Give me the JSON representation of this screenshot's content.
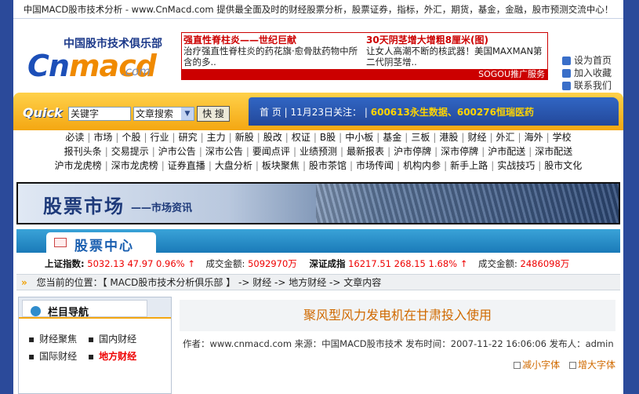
{
  "topbar": {
    "text": "中国MACD股市技术分析 - www.CnMacd.com 提供最全面及时的财经股票分析，股票证券，指标，外汇，期货，基金，金融，股市预测交流中心！"
  },
  "logo": {
    "cn_text": "中国股市技术俱乐部",
    "brand_a": "Cn",
    "brand_b": "macd",
    "domain": ".com"
  },
  "ad": {
    "left_title": "强直性脊柱炎——世纪巨献",
    "left_body": "治疗强直性脊柱炎的药花旗·愈骨肽药物中所含的多..",
    "right_title": "30天阴茎增大增粗8厘米(图)",
    "right_body": "让女人高潮不断的核武器！美国MAXMAN第二代阴茎增..",
    "footer": "SOGOU推广服务"
  },
  "quick_links": [
    "设为首页",
    "加入收藏",
    "联系我们"
  ],
  "search": {
    "logo_text": "Quick",
    "keyword_value": "关键字",
    "select_value": "文章搜索",
    "go_label": "快 搜"
  },
  "bluebar": {
    "home": "首 页",
    "date_label": "11月23日关注：",
    "hot": "600613永生数据、600276恒瑞医药"
  },
  "nav": {
    "row1": [
      "必读",
      "市场",
      "个股",
      "行业",
      "研究",
      "主力",
      "新股",
      "股改",
      "权证",
      "B股",
      "中小板",
      "基金",
      "三板",
      "港股",
      "财经",
      "外汇",
      "海外",
      "学校"
    ],
    "row2": [
      "报刊头条",
      "交易提示",
      "沪市公告",
      "深市公告",
      "要闻点评",
      "业绩预测",
      "最新报表",
      "沪市停牌",
      "深市停牌",
      "沪市配送",
      "深市配送"
    ],
    "row3": [
      "沪市龙虎榜",
      "深市龙虎榜",
      "证券直播",
      "大盘分析",
      "板块聚焦",
      "股市茶馆",
      "市场传闻",
      "机构内参",
      "新手上路",
      "实战技巧",
      "股市文化"
    ]
  },
  "banner": {
    "title": "股票市场",
    "subtitle": "——市场资讯"
  },
  "section": {
    "title": "股票中心"
  },
  "ticker": {
    "sh_label": "上证指数:",
    "sh_values": "5032.13  47.97  0.96% ↑",
    "sh_amount_label": "成交金额:",
    "sh_amount": "5092970万",
    "sz_label": "深证成指",
    "sz_values": "16217.51  268.15  1.68% ↑",
    "sz_amount_label": "成交金额:",
    "sz_amount": "2486098万"
  },
  "breadcrumb": {
    "prefix": "您当前的位置：【 MACD股市技术分析俱乐部 】 -> 财经 -> 地方财经 -> 文章内容"
  },
  "sidebar": {
    "title": "栏目导航",
    "items": [
      "财经聚焦",
      "国内财经",
      "国际财经",
      "地方财经"
    ]
  },
  "article": {
    "title": "聚风型风力发电机在甘肃投入使用",
    "meta": "作者：www.cnmacd.com  来源：中国MACD股市技术  发布时间：2007-11-22 16:06:06  发布人：admin",
    "font_smaller": "减小字体",
    "font_larger": "增大字体"
  }
}
